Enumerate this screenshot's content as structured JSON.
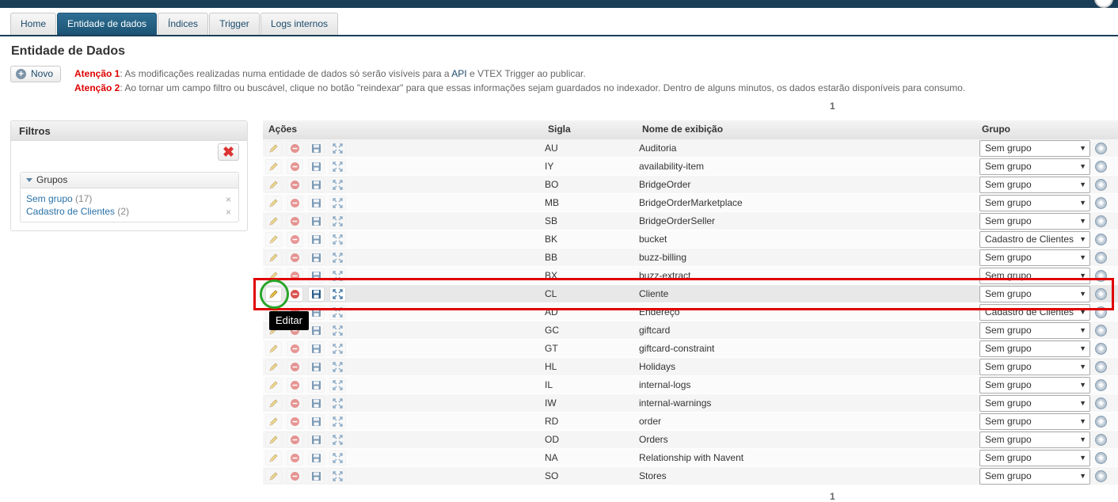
{
  "tabs": [
    "Home",
    "Entidade de dados",
    "Índices",
    "Trigger",
    "Logs internos"
  ],
  "page_title": "Entidade de Dados",
  "novo_label": "Novo",
  "warnings": {
    "w1_label": "Atenção 1",
    "w1_text_a": ": As modificações realizadas numa entidade de dados só serão visíveis para a ",
    "w1_link": "API",
    "w1_text_b": " e VTEX Trigger ao publicar.",
    "w2_label": "Atenção 2",
    "w2_text": ": Ao tornar um campo filtro ou buscável, clique no botão \"reindexar\" para que essas informações sejam guardados no indexador. Dentro de alguns minutos, os dados estarão disponíveis para consumo."
  },
  "pager": "1",
  "filters": {
    "title": "Filtros",
    "groups_title": "Grupos",
    "items": [
      {
        "label": "Sem grupo",
        "count": "(17)"
      },
      {
        "label": "Cadastro de Clientes",
        "count": "(2)"
      }
    ],
    "remove_glyph": "×"
  },
  "table": {
    "headers": {
      "acoes": "Ações",
      "sigla": "Sigla",
      "nome": "Nome de exibição",
      "grupo": "Grupo"
    },
    "rows": [
      {
        "sigla": "AU",
        "nome": "Auditoria",
        "grupo": "Sem grupo"
      },
      {
        "sigla": "IY",
        "nome": "availability-item",
        "grupo": "Sem grupo"
      },
      {
        "sigla": "BO",
        "nome": "BridgeOrder",
        "grupo": "Sem grupo"
      },
      {
        "sigla": "MB",
        "nome": "BridgeOrderMarketplace",
        "grupo": "Sem grupo"
      },
      {
        "sigla": "SB",
        "nome": "BridgeOrderSeller",
        "grupo": "Sem grupo"
      },
      {
        "sigla": "BK",
        "nome": "bucket",
        "grupo": "Cadastro de Clientes"
      },
      {
        "sigla": "BB",
        "nome": "buzz-billing",
        "grupo": "Sem grupo"
      },
      {
        "sigla": "BX",
        "nome": "buzz-extract",
        "grupo": "Sem grupo"
      },
      {
        "sigla": "CL",
        "nome": "Cliente",
        "grupo": "Sem grupo"
      },
      {
        "sigla": "AD",
        "nome": "Endereço",
        "grupo": "Cadastro de Clientes"
      },
      {
        "sigla": "GC",
        "nome": "giftcard",
        "grupo": "Sem grupo"
      },
      {
        "sigla": "GT",
        "nome": "giftcard-constraint",
        "grupo": "Sem grupo"
      },
      {
        "sigla": "HL",
        "nome": "Holidays",
        "grupo": "Sem grupo"
      },
      {
        "sigla": "IL",
        "nome": "internal-logs",
        "grupo": "Sem grupo"
      },
      {
        "sigla": "IW",
        "nome": "internal-warnings",
        "grupo": "Sem grupo"
      },
      {
        "sigla": "RD",
        "nome": "order",
        "grupo": "Sem grupo"
      },
      {
        "sigla": "OD",
        "nome": "Orders",
        "grupo": "Sem grupo"
      },
      {
        "sigla": "NA",
        "nome": "Relationship with Navent",
        "grupo": "Sem grupo"
      },
      {
        "sigla": "SO",
        "nome": "Stores",
        "grupo": "Sem grupo"
      }
    ],
    "highlight_row_index": 8
  },
  "tooltip": "Editar",
  "colors": {
    "brand_dark": "#1b3e58",
    "highlight_box": "#e00000",
    "focus_circle": "#2aa52a",
    "warning": "#dd0000"
  }
}
